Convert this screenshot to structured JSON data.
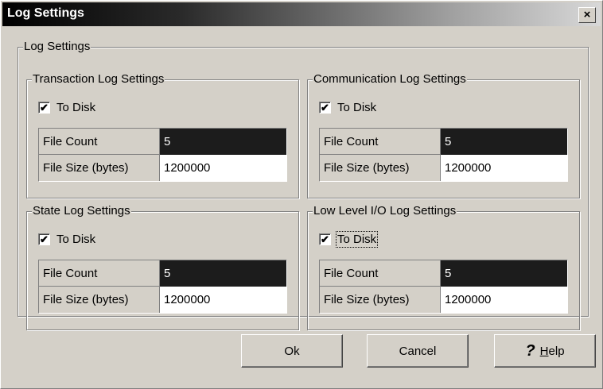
{
  "window": {
    "title": "Log Settings",
    "close_glyph": "×"
  },
  "outer_group": {
    "label": "Log Settings"
  },
  "groups": [
    {
      "label": "Transaction Log Settings",
      "checkbox_label": "To Disk",
      "checked": true,
      "rows": [
        {
          "label": "File Count",
          "value": "5"
        },
        {
          "label": "File Size (bytes)",
          "value": "1200000"
        }
      ]
    },
    {
      "label": "Communication Log Settings",
      "checkbox_label": "To Disk",
      "checked": true,
      "rows": [
        {
          "label": "File Count",
          "value": "5"
        },
        {
          "label": "File Size (bytes)",
          "value": "1200000"
        }
      ]
    },
    {
      "label": "State Log Settings",
      "checkbox_label": "To Disk",
      "checked": true,
      "rows": [
        {
          "label": "File Count",
          "value": "5"
        },
        {
          "label": "File Size (bytes)",
          "value": "1200000"
        }
      ]
    },
    {
      "label": "Low Level I/O Log Settings",
      "checkbox_label": "To Disk",
      "checked": true,
      "rows": [
        {
          "label": "File Count",
          "value": "5"
        },
        {
          "label": "File Size (bytes)",
          "value": "1200000"
        }
      ]
    }
  ],
  "buttons": {
    "ok": "Ok",
    "cancel": "Cancel",
    "help_icon": "?",
    "help_mnemonic": "H",
    "help_rest": "elp"
  },
  "check_glyph": "✔"
}
